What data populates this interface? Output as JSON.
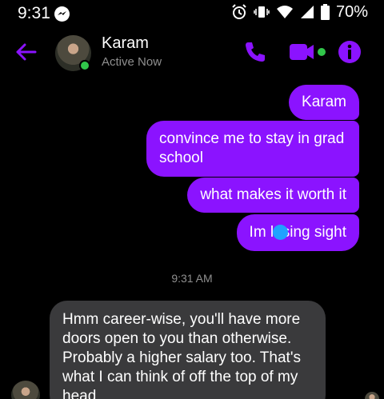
{
  "status_bar": {
    "time": "9:31",
    "battery": "70%"
  },
  "header": {
    "contact_name": "Karam",
    "contact_status": "Active Now"
  },
  "messages": {
    "sent": [
      "Karam",
      "convince me to stay in grad school",
      "what makes it worth it",
      "Im losing sight"
    ],
    "timestamp": "9:31 AM",
    "received": [
      "Hmm career-wise, you'll have more doors open to you than otherwise. Probably a higher salary too. That's what I can think of off the top of my head"
    ]
  },
  "colors": {
    "accent": "#8b13ff",
    "background": "#000000",
    "incoming_bubble": "#3a3a3c",
    "online": "#31c64a"
  }
}
